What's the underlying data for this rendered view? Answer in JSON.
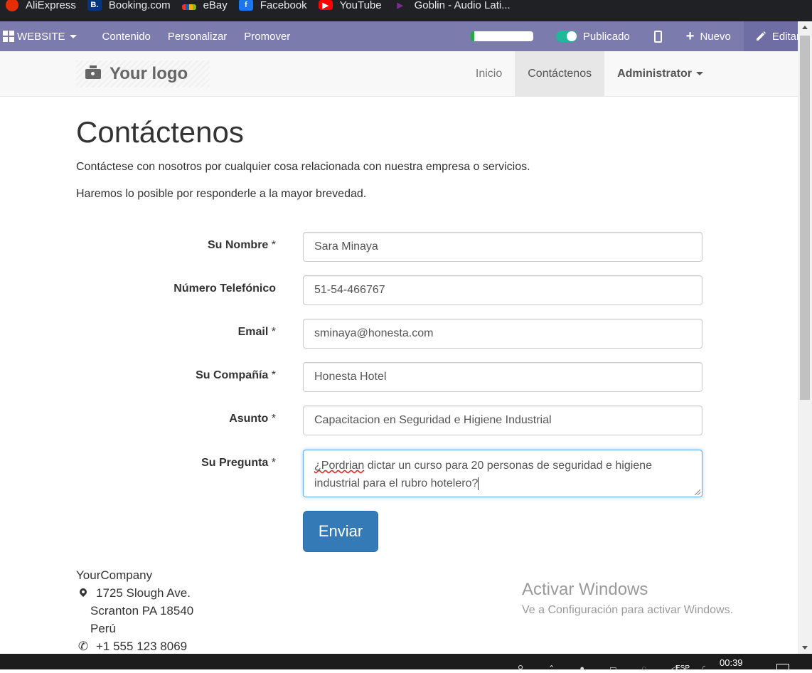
{
  "bookmarks": [
    {
      "label": "AliExpress",
      "icon": "aliexpress-icon"
    },
    {
      "label": "Booking.com",
      "icon": "booking-icon"
    },
    {
      "label": "eBay",
      "icon": "ebay-icon"
    },
    {
      "label": "Facebook",
      "icon": "facebook-icon"
    },
    {
      "label": "YouTube",
      "icon": "youtube-icon"
    },
    {
      "label": "Goblin - Audio Lati...",
      "icon": "goblin-icon"
    }
  ],
  "adminbar": {
    "website": "WEBSITE",
    "contenido": "Contenido",
    "personalizar": "Personalizar",
    "promover": "Promover",
    "publicado": "Publicado",
    "nuevo": "Nuevo",
    "editar": "Editar",
    "colors": {
      "bar": "#7c7bad",
      "toggle": "#21b799"
    }
  },
  "navbar": {
    "logo": "Your logo",
    "items": [
      "Inicio",
      "Contáctenos",
      "Administrator"
    ]
  },
  "page": {
    "title": "Contáctenos",
    "intro1": "Contáctese con nosotros por cualquier cosa relacionada con nuestra empresa o servicios.",
    "intro2": "Haremos lo posible por responderle a la mayor brevedad."
  },
  "form": {
    "name": {
      "label": "Su Nombre",
      "required": "*",
      "value": "Sara Minaya"
    },
    "phone": {
      "label": "Número Telefónico",
      "value": "51-54-466767"
    },
    "email": {
      "label": "Email",
      "required": "*",
      "value": "sminaya@honesta.com"
    },
    "company": {
      "label": "Su Compañía",
      "required": "*",
      "value": "Honesta Hotel"
    },
    "subject": {
      "label": "Asunto",
      "required": "*",
      "value": "Capacitacion en Seguridad e Higiene Industrial"
    },
    "question": {
      "label": "Su Pregunta",
      "required": "*",
      "value_misspelled": "¿Pordrian",
      "value_rest": " dictar un curso para 20 personas de seguridad e higiene industrial para el rubro hotelero?"
    },
    "submit": "Enviar",
    "colors": {
      "submit": "#337ab7",
      "focus": "#66afe9"
    }
  },
  "footer": {
    "company": "YourCompany",
    "address1": "1725 Slough Ave.",
    "address2": "Scranton PA 18540",
    "country": "Perú",
    "phone": "+1 555 123 8069"
  },
  "watermark": {
    "title": "Activar Windows",
    "subtitle": "Ve a Configuración para activar Windows."
  },
  "taskbar": {
    "clock": "00:39",
    "lang": "ESP"
  }
}
